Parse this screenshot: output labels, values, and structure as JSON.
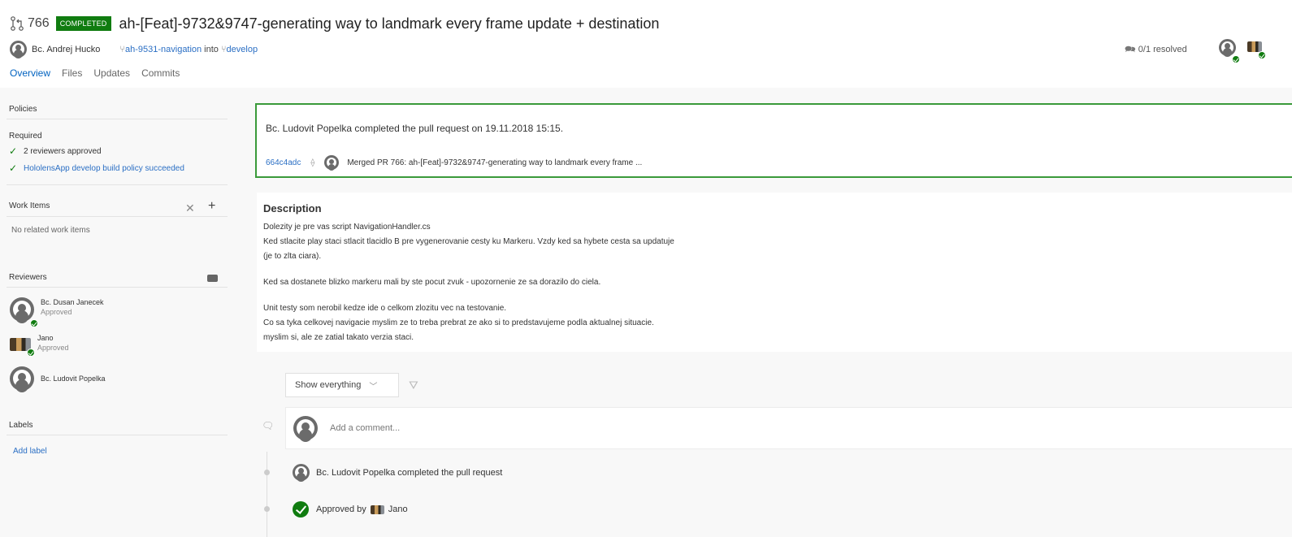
{
  "header": {
    "pr_number": "766",
    "status_badge": "COMPLETED",
    "title": "ah-[Feat]-9732&9747-generating way to landmark every frame update + destination",
    "author": "Bc. Andrej Hucko",
    "source_branch": "ah-9531-navigation",
    "into_text": "into",
    "target_branch": "develop",
    "resolved": "0/1 resolved",
    "tabs": [
      "Overview",
      "Files",
      "Updates",
      "Commits"
    ]
  },
  "sidebar": {
    "policies_title": "Policies",
    "required_label": "Required",
    "policies": [
      {
        "label": "2 reviewers approved",
        "link": false
      },
      {
        "label": "HololensApp develop build policy succeeded",
        "link": true
      }
    ],
    "work_items_title": "Work Items",
    "work_items_empty": "No related work items",
    "reviewers_title": "Reviewers",
    "reviewers": [
      {
        "name": "Bc. Dusan Janecek",
        "status": "Approved"
      },
      {
        "name": "Jano",
        "status": "Approved"
      },
      {
        "name": "Bc. Ludovit Popelka",
        "status": ""
      }
    ],
    "labels_title": "Labels",
    "add_label": "Add label"
  },
  "completed_card": {
    "text": "Bc. Ludovit Popelka completed the pull request on 19.11.2018 15:15.",
    "commit": "664c4adc",
    "merged_message": "Merged PR 766: ah-[Feat]-9732&9747-generating way to landmark every frame ..."
  },
  "description": {
    "title": "Description",
    "lines": [
      "Dolezity je pre vas script NavigationHandler.cs",
      "Ked stlacite play staci stlacit tlacidlo B pre vygenerovanie cesty ku Markeru. Vzdy ked sa hybete cesta sa updatuje",
      "(je to zlta ciara).",
      "Ked sa dostanete blizko markeru mali by ste pocut zvuk - upozornenie ze sa dorazilo do ciela.",
      "Unit testy som nerobil kedze ide o celkom zlozitu vec na testovanie.",
      "Co sa tyka celkovej navigacie myslim ze to treba prebrat ze ako si to predstavujeme podla aktualnej situacie.",
      "myslim si, ale ze zatial takato verzia staci."
    ]
  },
  "activity": {
    "filter_value": "Show everything",
    "comment_placeholder": "Add a comment...",
    "events": [
      "Bc. Ludovit Popelka completed the pull request",
      "Approved by",
      "Jano"
    ]
  },
  "colors": {
    "accent": "#0062c0",
    "success": "#107c10",
    "link": "#2b6fc4"
  }
}
